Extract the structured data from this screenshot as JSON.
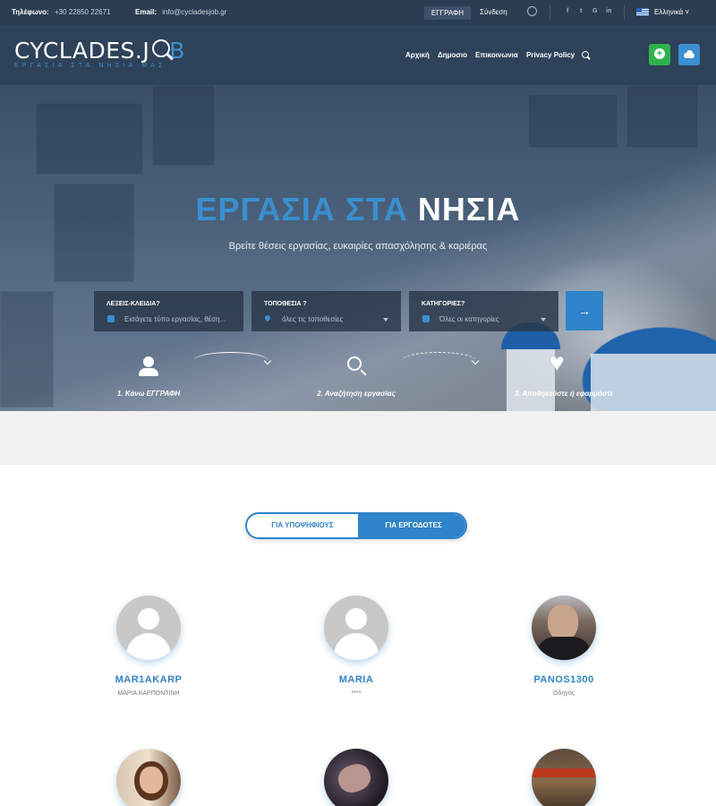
{
  "topbar": {
    "phone_label": "Τηλέφωνο:",
    "phone": "+30 22850 22671",
    "email_label": "Email:",
    "email": "info@cycladesjob.gr",
    "register": "ΕΓΓΡΑΦΗ",
    "login": "Σύνδεση",
    "social": [
      "f",
      "t",
      "G",
      "in"
    ],
    "language": "Ελληνικά"
  },
  "brand": {
    "name_main": "CYCLADES.J",
    "name_end": "B",
    "tagline": "ΕΡΓΑΣΙΑ ΣΤΑ ΝΗΣΙΑ ΜΑΣ"
  },
  "nav": {
    "items": [
      "Αρχική",
      "Δημοσιο",
      "Επικοινωνια",
      "Privacy Policy"
    ]
  },
  "hero": {
    "title_a": "ΕΡΓΑΣΙΑ ΣΤΑ",
    "title_b": "ΝΗΣΙΑ",
    "subtitle": "Βρείτε θέσεις εργασίας, ευκαιρίες απασχόλησης & καριέρας",
    "search": [
      {
        "label": "ΛΕΞΕΙΣ-ΚΛΕΙΔΙΑ?",
        "value": "Εισάγετε τύπο εργασίας, θέση..."
      },
      {
        "label": "ΤΟΠΟΘΕΣΙΑ ?",
        "value": "όλες τις τοποθεσίες"
      },
      {
        "label": "ΚΑΤΗΓΟΡΙΕΣ?",
        "value": "Όλες οι κατηγορίες"
      }
    ],
    "go": "→",
    "steps": [
      "1. Κάνω ΕΓΓΡΑΦΗ",
      "2. Αναζήτηση εργασίας",
      "3. Αποθηκεύστε ή εφαρμόστε"
    ]
  },
  "toggle": {
    "candidates": "ΓΙΑ ΥΠΟΨΗΦΙΟΥΣ",
    "employers": "ΓΙΑ ΕΡΓΟΔΟΤΕΣ"
  },
  "profiles": [
    {
      "name": "MAR1AKARP",
      "role": "ΜΑΡΙΑ ΚΑΡΠΟΝΤΙΝΗ"
    },
    {
      "name": "MARIA",
      "role": "****"
    },
    {
      "name": "PANOS1300",
      "role": "Οδηγός"
    }
  ],
  "colors": {
    "accent": "#2f84c9",
    "green": "#2fb24c",
    "topbar": "#2b3d52",
    "nav": "#2e4259"
  }
}
